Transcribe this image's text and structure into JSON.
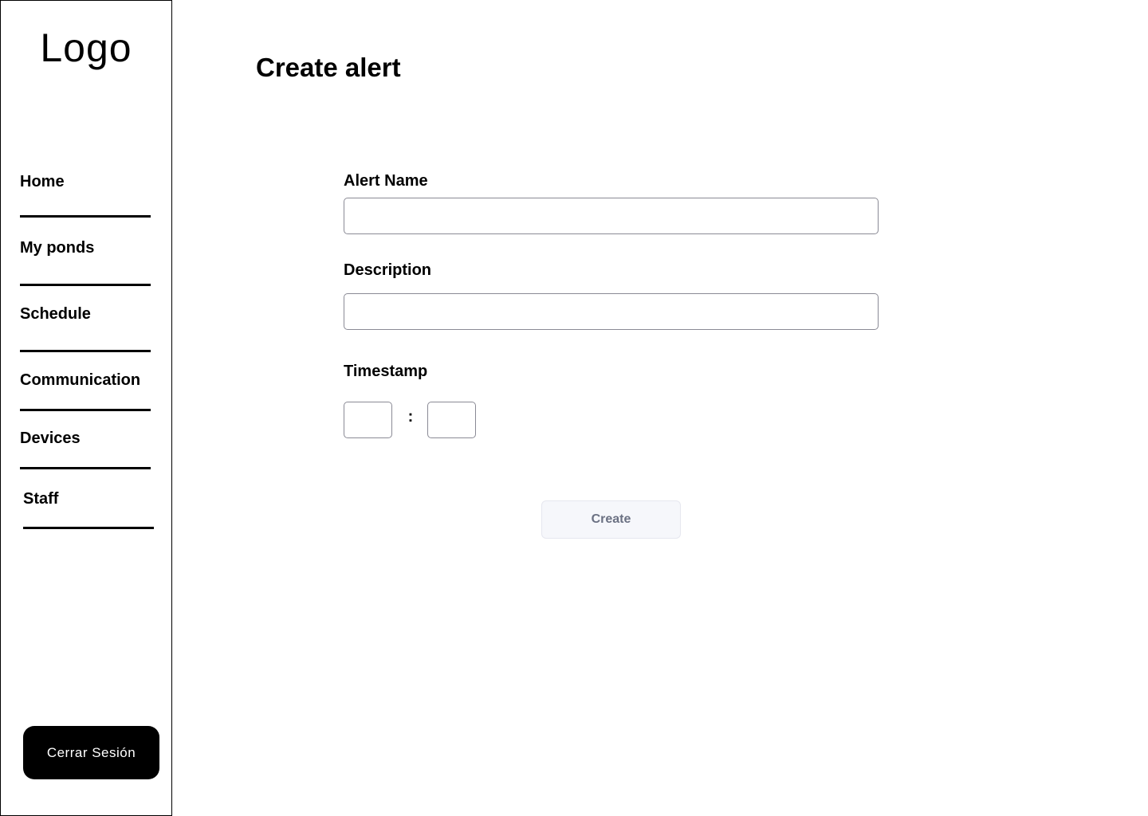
{
  "sidebar": {
    "logo": "Logo",
    "items": [
      {
        "label": "Home"
      },
      {
        "label": "My ponds"
      },
      {
        "label": "Schedule"
      },
      {
        "label": "Communication"
      },
      {
        "label": "Devices"
      },
      {
        "label": "Staff"
      }
    ],
    "logout_label": "Cerrar Sesión"
  },
  "main": {
    "title": "Create alert",
    "form": {
      "alert_name": {
        "label": "Alert Name",
        "value": "",
        "placeholder": ""
      },
      "description": {
        "label": "Description",
        "value": "",
        "placeholder": ""
      },
      "timestamp": {
        "label": "Timestamp",
        "hours": "",
        "minutes": "",
        "separator": ":"
      },
      "submit_label": "Create"
    }
  },
  "colors": {
    "sidebar_border": "#000000",
    "logout_background": "#000000",
    "create_button_background": "#f6f7fb",
    "create_button_text": "#6b7183"
  }
}
